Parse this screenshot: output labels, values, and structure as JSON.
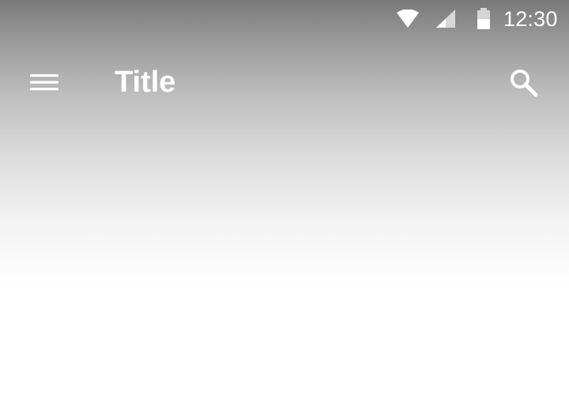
{
  "status_bar": {
    "time": "12:30",
    "icons": [
      "wifi-icon",
      "signal-icon",
      "battery-icon"
    ]
  },
  "toolbar": {
    "title": "Title",
    "nav_icon": "menu-icon",
    "action_icon": "search-icon"
  },
  "colors": {
    "scrim_top": "#7a797a",
    "background": "#ffffff",
    "foreground": "#ffffff"
  }
}
